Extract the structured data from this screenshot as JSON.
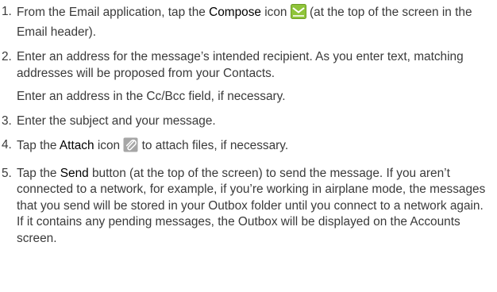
{
  "steps": [
    {
      "number": "1.",
      "text_a": "From the Email application, tap the ",
      "bold": "Compose",
      "text_b": " icon ",
      "icon": "compose-envelope-icon",
      "text_c": " (at the top of the screen in the Email header)."
    },
    {
      "number": "2.",
      "text": "Enter an address for the message’s intended recipient. As you enter text, matching addresses will be proposed from your Contacts."
    },
    {
      "number": "3.",
      "text": "Enter the subject and your message."
    },
    {
      "number": "4.",
      "text_a": "Tap the ",
      "bold": "Attach",
      "text_b": " icon ",
      "icon": "paperclip-attach-icon",
      "text_c": " to attach files, if necessary."
    },
    {
      "number": "5.",
      "text_a": "Tap the ",
      "bold": "Send",
      "text_b": " button (at the top of the screen) to send the message. If you aren’t connected to a network, for example, if you’re working in airplane mode, the messages that you send will be stored in your Outbox folder until you connect to a network again. If it contains any pending messages, the Outbox will be displayed on the Accounts screen."
    }
  ],
  "note_after_step_2": "Enter an address in the Cc/Bcc field, if necessary.",
  "colors": {
    "text": "#3a3a3a",
    "bold": "#000000",
    "compose_icon_bg": "#8fc43a",
    "attach_icon_bg": "#a6a6a6"
  }
}
